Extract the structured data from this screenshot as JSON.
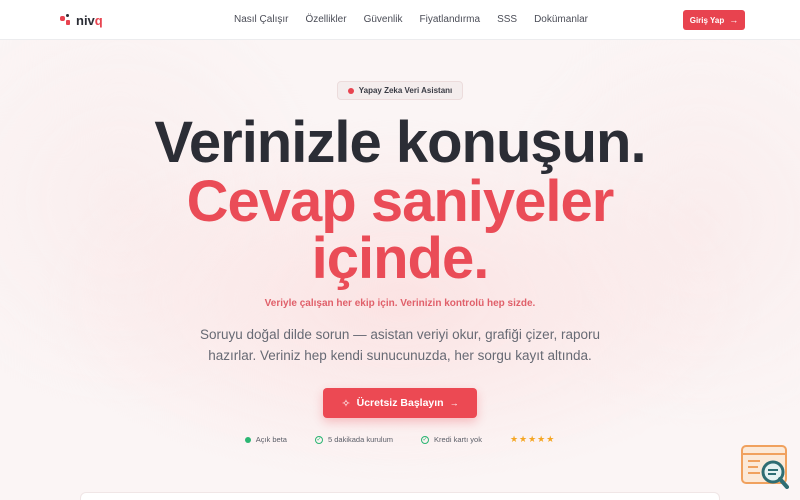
{
  "brand": {
    "name_main": "niv",
    "name_accent": "q",
    "accent": "#e8434f"
  },
  "nav": {
    "links": [
      "Nasıl Çalışır",
      "Özellikler",
      "Güvenlik",
      "Fiyatlandırma",
      "SSS",
      "Dokümanlar"
    ],
    "login_label": "Giriş Yap"
  },
  "hero": {
    "badge": "Yapay Zeka Veri Asistanı",
    "line1": "Verinizle konuşun.",
    "line2": "Cevap saniyeler",
    "line3": "içinde.",
    "tagline": "Veriyle çalışan her ekip için. Verinizin kontrolü hep sizde.",
    "description": "Soruyu doğal dilde sorun — asistan veriyi okur, grafiği çizer, raporu hazırlar. Veriniz hep kendi sunucunuzda, her sorgu kayıt altında.",
    "cta_label": "Ücretsiz Başlayın"
  },
  "features": {
    "beta": "Açık beta",
    "setup": "5 dakikada kurulum",
    "no_card": "Kredi kartı yok",
    "stars": "★★★★★"
  },
  "icons": {
    "logo": "logo-mark-icon",
    "arrow": "arrow-right-icon",
    "sparkle": "sparkle-icon",
    "check": "check-circle-icon",
    "chat": "chat-search-icon"
  }
}
